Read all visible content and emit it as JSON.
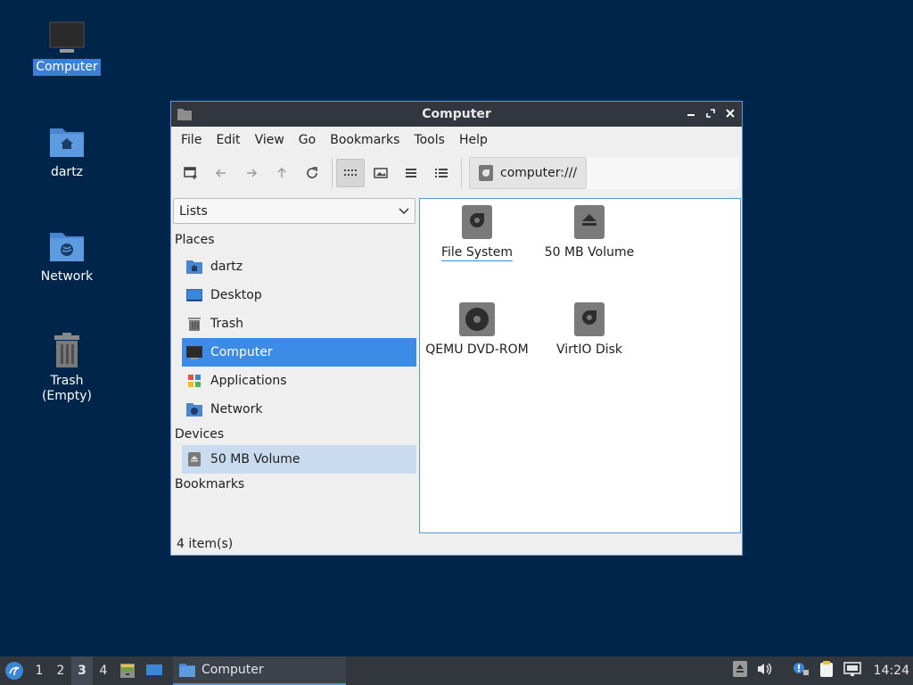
{
  "desktop": {
    "icons": [
      {
        "label": "Computer"
      },
      {
        "label": "dartz"
      },
      {
        "label": "Network"
      },
      {
        "label": "Trash (Empty)"
      }
    ]
  },
  "window": {
    "title": "Computer",
    "menu": [
      "File",
      "Edit",
      "View",
      "Go",
      "Bookmarks",
      "Tools",
      "Help"
    ],
    "path": "computer:///",
    "sidebar": {
      "mode": "Lists",
      "places_heading": "Places",
      "places": [
        {
          "label": "dartz"
        },
        {
          "label": "Desktop"
        },
        {
          "label": "Trash"
        },
        {
          "label": "Computer"
        },
        {
          "label": "Applications"
        },
        {
          "label": "Network"
        }
      ],
      "devices_heading": "Devices",
      "devices": [
        {
          "label": "50 MB Volume"
        }
      ],
      "bookmarks_heading": "Bookmarks"
    },
    "files": [
      {
        "label": "File System"
      },
      {
        "label": "50 MB Volume"
      },
      {
        "label": "QEMU DVD-ROM"
      },
      {
        "label": "VirtIO Disk"
      }
    ],
    "status": "4 item(s)"
  },
  "taskbar": {
    "workspaces": [
      "1",
      "2",
      "3",
      "4"
    ],
    "task_label": "Computer",
    "clock": "14:24"
  },
  "colors": {
    "desktop_bg": "#00254a",
    "accent": "#3c8ce7",
    "selection_light": "#c9dbee"
  }
}
